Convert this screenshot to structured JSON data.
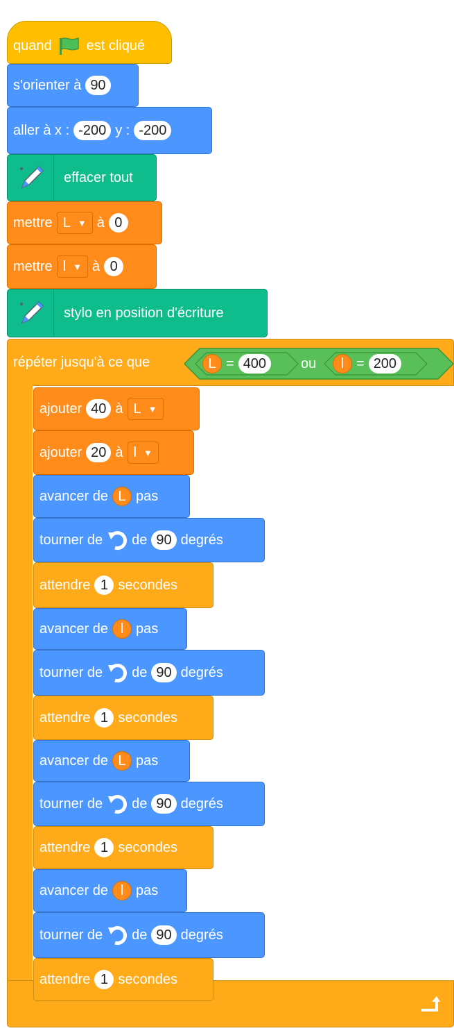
{
  "script": {
    "when_flag": {
      "before": "quand",
      "after": "est cliqué"
    },
    "point_direction": {
      "label": "s'orienter à",
      "value": "90"
    },
    "goto_xy": {
      "label": "aller à x :",
      "x": "-200",
      "ylabel": "y :",
      "y": "-200"
    },
    "erase_all": {
      "label": "effacer tout"
    },
    "set_L": {
      "label": "mettre",
      "var": "L",
      "to": "à",
      "value": "0"
    },
    "set_l": {
      "label": "mettre",
      "var": "l",
      "to": "à",
      "value": "0"
    },
    "pen_down": {
      "label": "stylo en position d'écriture"
    },
    "repeat_until": {
      "label": "répéter jusqu'à ce que",
      "cond1": {
        "var": "L",
        "op": "=",
        "value": "400"
      },
      "or_label": "ou",
      "cond2": {
        "var": "l",
        "op": "=",
        "value": "200"
      }
    },
    "body": {
      "add_L": {
        "label": "ajouter",
        "value": "40",
        "to": "à",
        "var": "L"
      },
      "add_l": {
        "label": "ajouter",
        "value": "20",
        "to": "à",
        "var": "l"
      },
      "move_L_1": {
        "label": "avancer de",
        "var": "L",
        "suffix": "pas"
      },
      "turn_1": {
        "label": "tourner de",
        "de": "de",
        "value": "90",
        "suffix": "degrés"
      },
      "wait_1": {
        "label": "attendre",
        "value": "1",
        "suffix": "secondes"
      },
      "move_l_1": {
        "label": "avancer de",
        "var": "l",
        "suffix": "pas"
      },
      "turn_2": {
        "label": "tourner de",
        "de": "de",
        "value": "90",
        "suffix": "degrés"
      },
      "wait_2": {
        "label": "attendre",
        "value": "1",
        "suffix": "secondes"
      },
      "move_L_2": {
        "label": "avancer de",
        "var": "L",
        "suffix": "pas"
      },
      "turn_3": {
        "label": "tourner de",
        "de": "de",
        "value": "90",
        "suffix": "degrés"
      },
      "wait_3": {
        "label": "attendre",
        "value": "1",
        "suffix": "secondes"
      },
      "move_l_2": {
        "label": "avancer de",
        "var": "l",
        "suffix": "pas"
      },
      "turn_4": {
        "label": "tourner de",
        "de": "de",
        "value": "90",
        "suffix": "degrés"
      },
      "wait_4": {
        "label": "attendre",
        "value": "1",
        "suffix": "secondes"
      }
    }
  },
  "icons": {
    "flag": "green-flag-icon",
    "pen": "pen-icon",
    "rotate": "rotate-left-icon",
    "loop_arrow": "loop-arrow-icon",
    "dropdown": "dropdown-arrow-icon"
  },
  "colors": {
    "motion": "#4c97ff",
    "events": "#ffbf00",
    "pen": "#0fbd8c",
    "variables": "#ff8c1a",
    "control": "#ffab19",
    "operators": "#59c059"
  }
}
